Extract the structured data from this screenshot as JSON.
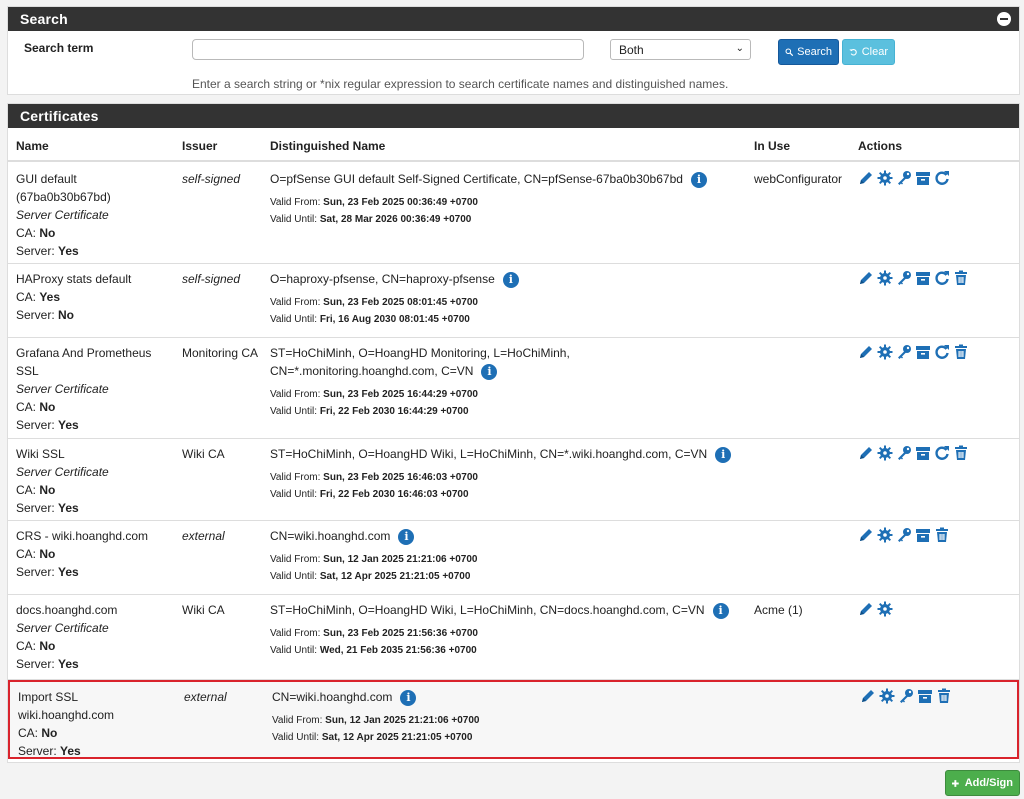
{
  "search": {
    "title": "Search",
    "term_label": "Search term",
    "term_value": "",
    "scope_value": "Both",
    "search_label": "Search",
    "clear_label": "Clear",
    "help": "Enter a search string or *nix regular expression to search certificate names and distinguished names."
  },
  "certs": {
    "title": "Certificates",
    "columns": [
      "Name",
      "Issuer",
      "Distinguished Name",
      "In Use",
      "Actions"
    ],
    "rows": [
      {
        "name_lines": [
          "GUI default",
          "(67ba0b30b67bd)"
        ],
        "type": "Server Certificate",
        "ca_label": "CA: ",
        "ca": "No",
        "server_label": "Server: ",
        "server": "Yes",
        "issuer": "self-signed",
        "issuer_italic": true,
        "dn": [
          "O=pfSense GUI default Self-Signed Certificate, CN=pfSense-67ba0b30b67bd"
        ],
        "valid_from_label": "Valid From: ",
        "valid_from": "Sun, 23 Feb 2025 00:36:49 +0700",
        "valid_until_label": "Valid Until: ",
        "valid_until": "Sat, 28 Mar 2026 00:36:49 +0700",
        "in_use": "webConfigurator",
        "actions": [
          "edit",
          "gear",
          "key",
          "archive",
          "renew"
        ]
      },
      {
        "name_lines": [
          "HAProxy stats default"
        ],
        "type": "",
        "ca_label": "CA: ",
        "ca": "Yes",
        "server_label": "Server: ",
        "server": "No",
        "issuer": "self-signed",
        "issuer_italic": true,
        "dn": [
          "O=haproxy-pfsense, CN=haproxy-pfsense"
        ],
        "valid_from_label": "Valid From: ",
        "valid_from": "Sun, 23 Feb 2025 08:01:45 +0700",
        "valid_until_label": "Valid Until: ",
        "valid_until": "Fri, 16 Aug 2030 08:01:45 +0700",
        "in_use": "",
        "actions": [
          "edit",
          "gear",
          "key",
          "archive",
          "renew",
          "trash"
        ]
      },
      {
        "name_lines": [
          "Grafana And Prometheus",
          "SSL"
        ],
        "type": "Server Certificate",
        "ca_label": "CA: ",
        "ca": "No",
        "server_label": "Server: ",
        "server": "Yes",
        "issuer": "Monitoring CA",
        "issuer_italic": false,
        "dn": [
          "ST=HoChiMinh, O=HoangHD Monitoring, L=HoChiMinh,",
          "CN=*.monitoring.hoanghd.com, C=VN"
        ],
        "valid_from_label": "Valid From: ",
        "valid_from": "Sun, 23 Feb 2025 16:44:29 +0700",
        "valid_until_label": "Valid Until: ",
        "valid_until": "Fri, 22 Feb 2030 16:44:29 +0700",
        "in_use": "",
        "actions": [
          "edit",
          "gear",
          "key",
          "archive",
          "renew",
          "trash"
        ]
      },
      {
        "name_lines": [
          "Wiki SSL"
        ],
        "type": "Server Certificate",
        "ca_label": "CA: ",
        "ca": "No",
        "server_label": "Server: ",
        "server": "Yes",
        "issuer": "Wiki CA",
        "issuer_italic": false,
        "dn": [
          "ST=HoChiMinh, O=HoangHD Wiki, L=HoChiMinh, CN=*.wiki.hoanghd.com, C=VN"
        ],
        "valid_from_label": "Valid From: ",
        "valid_from": "Sun, 23 Feb 2025 16:46:03 +0700",
        "valid_until_label": "Valid Until: ",
        "valid_until": "Fri, 22 Feb 2030 16:46:03 +0700",
        "in_use": "",
        "actions": [
          "edit",
          "gear",
          "key",
          "archive",
          "renew",
          "trash"
        ]
      },
      {
        "name_lines": [
          "CRS - wiki.hoanghd.com"
        ],
        "type": "",
        "ca_label": "CA: ",
        "ca": "No",
        "server_label": "Server: ",
        "server": "Yes",
        "issuer": "external",
        "issuer_italic": true,
        "dn": [
          "CN=wiki.hoanghd.com"
        ],
        "valid_from_label": "Valid From: ",
        "valid_from": "Sun, 12 Jan 2025 21:21:06 +0700",
        "valid_until_label": "Valid Until: ",
        "valid_until": "Sat, 12 Apr 2025 21:21:05 +0700",
        "in_use": "",
        "actions": [
          "edit",
          "gear",
          "key",
          "archive",
          "trash"
        ]
      },
      {
        "name_lines": [
          "docs.hoanghd.com"
        ],
        "type": "Server Certificate",
        "ca_label": "CA: ",
        "ca": "No",
        "server_label": "Server: ",
        "server": "Yes",
        "issuer": "Wiki CA",
        "issuer_italic": false,
        "dn": [
          "ST=HoChiMinh, O=HoangHD Wiki, L=HoChiMinh, CN=docs.hoanghd.com, C=VN"
        ],
        "valid_from_label": "Valid From: ",
        "valid_from": "Sun, 23 Feb 2025 21:56:36 +0700",
        "valid_until_label": "Valid Until: ",
        "valid_until": "Wed, 21 Feb 2035 21:56:36 +0700",
        "in_use": "Acme (1)",
        "actions": [
          "edit",
          "gear"
        ]
      },
      {
        "name_lines": [
          "Import SSL",
          "wiki.hoanghd.com"
        ],
        "type": "",
        "ca_label": "CA: ",
        "ca": "No",
        "server_label": "Server: ",
        "server": "Yes",
        "issuer": "external",
        "issuer_italic": true,
        "dn": [
          "CN=wiki.hoanghd.com"
        ],
        "valid_from_label": "Valid From: ",
        "valid_from": "Sun, 12 Jan 2025 21:21:06 +0700",
        "valid_until_label": "Valid Until: ",
        "valid_until": "Sat, 12 Apr 2025 21:21:05 +0700",
        "in_use": "",
        "actions": [
          "edit",
          "gear",
          "key",
          "archive",
          "trash"
        ],
        "highlighted": true
      }
    ],
    "add_label": "Add/Sign"
  },
  "colors": {
    "header": "#333333",
    "primary": "#1e6fb5",
    "info_btn": "#5bc0de",
    "success": "#4cae4c",
    "highlight": "#d9232c"
  }
}
